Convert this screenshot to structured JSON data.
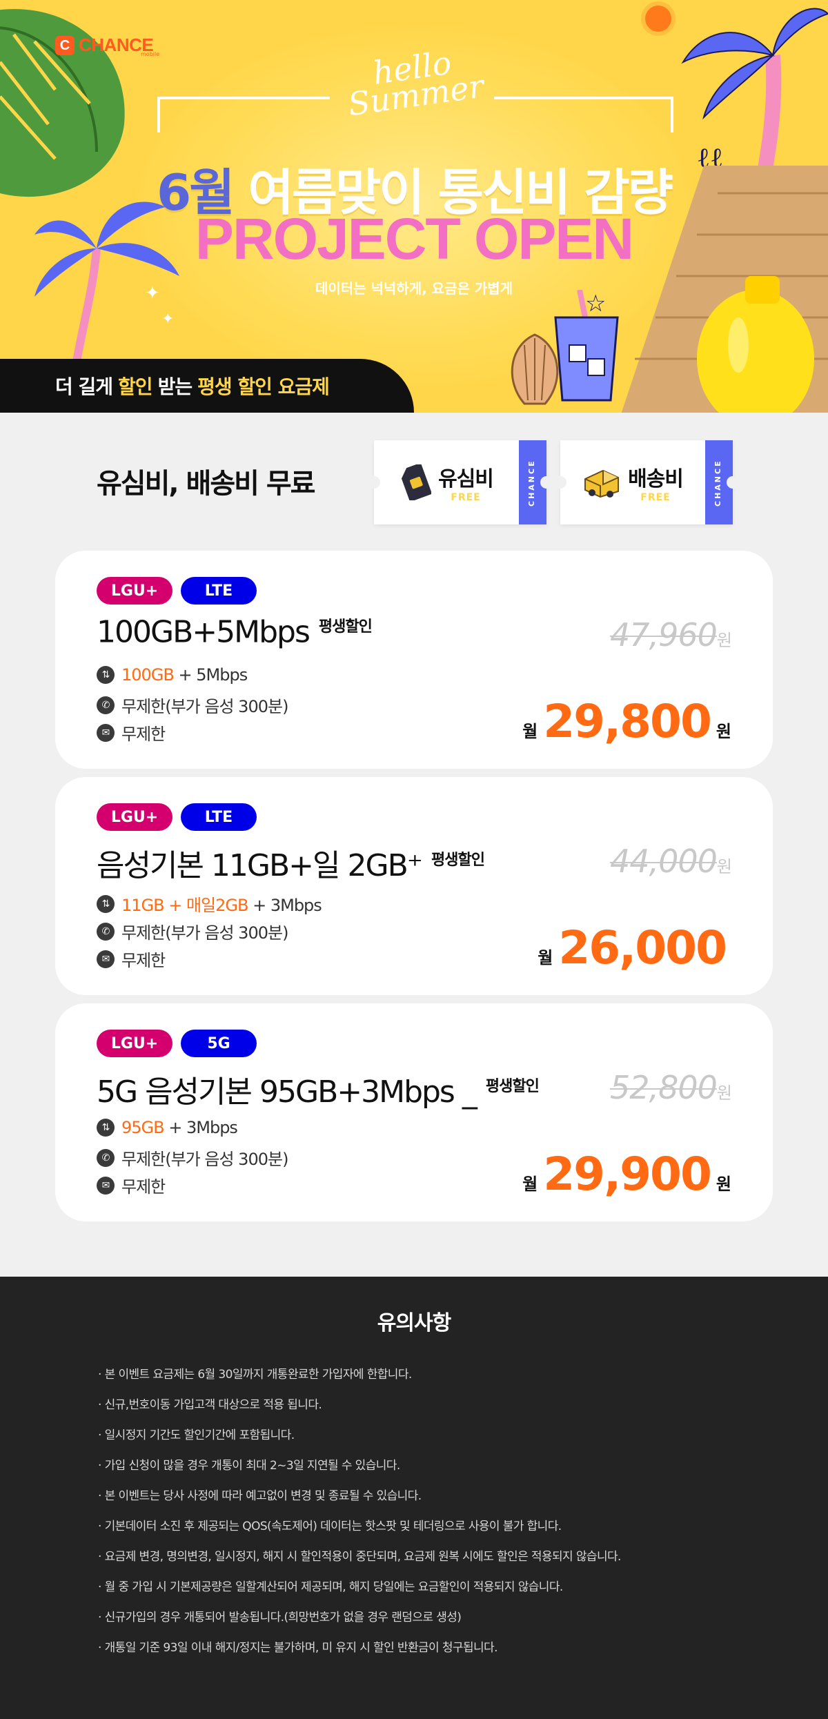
{
  "hero": {
    "brand": "CHANCE",
    "brand_sub": "mobile",
    "hello_line1": "hello",
    "hello_line2": "Summer",
    "headline_month": "6월",
    "headline_rest": " 여름맞이 통신비 감량",
    "project": "PROJECT OPEN",
    "subtitle": "데이터는 넉넉하게, 요금은 가볍게",
    "banner_pre": "더 길게",
    "banner_hl1": "할인",
    "banner_mid": "받는",
    "banner_hl2": "평생 할인 요금제",
    "colors": {
      "background": "#ffd64a",
      "accent_blue": "#5a67d8",
      "accent_pink": "#f26fc3"
    }
  },
  "free": {
    "title": "유심비, 배송비 무료",
    "tickets": [
      {
        "icon": "sim-card-icon",
        "name": "유심비",
        "free": "FREE",
        "stub": "CHANCE"
      },
      {
        "icon": "delivery-truck-icon",
        "name": "배송비",
        "free": "FREE",
        "stub": "CHANCE"
      }
    ]
  },
  "plans": [
    {
      "carrier": "LGU+",
      "network": "LTE",
      "name": "100GB+5Mbps",
      "tag": "평생할인",
      "data_hl": "100GB",
      "data_rest": " + 5Mbps",
      "voice": "무제한(부가 음성 300분)",
      "sms": "무제한",
      "orig_price": "47,960",
      "orig_unit": "원",
      "price_prefix": "월",
      "price": "29,800",
      "price_unit": "원"
    },
    {
      "carrier": "LGU+",
      "network": "LTE",
      "name": "음성기본 11GB+일 2GB⁺",
      "tag": "평생할인",
      "data_hl": "11GB + 매일2GB",
      "data_rest": " + 3Mbps",
      "voice": "무제한(부가 음성 300분)",
      "sms": "무제한",
      "orig_price": "44,000",
      "orig_unit": "원",
      "price_prefix": "월",
      "price": "26,000",
      "price_unit": ""
    },
    {
      "carrier": "LGU+",
      "network": "5G",
      "name": "5G 음성기본 95GB+3Mbps _",
      "tag": "평생할인",
      "data_hl": "95GB",
      "data_rest": " + 3Mbps",
      "voice": "무제한(부가 음성 300분)",
      "sms": "무제한",
      "orig_price": "52,800",
      "orig_unit": "원",
      "price_prefix": "월",
      "price": "29,900",
      "price_unit": "원"
    }
  ],
  "notice": {
    "title": "유의사항",
    "items": [
      "본 이벤트 요금제는 6월 30일까지 개통완료한 가입자에 한합니다.",
      "신규,번호이동 가입고객 대상으로 적용 됩니다.",
      "일시정지 기간도 할인기간에 포함됩니다.",
      "가입 신청이 많을 경우 개통이 최대 2~3일 지연될 수 있습니다.",
      "본 이벤트는 당사 사정에 따라 예고없이 변경 및 종료될 수 있습니다.",
      "기본데이터 소진 후 제공되는 QOS(속도제어) 데이터는 핫스팟 및 테더링으로 사용이 불가 합니다.",
      "요금제 변경, 명의변경, 일시정지, 해지 시 할인적용이 중단되며, 요금제 원복 시에도 할인은 적용되지 않습니다.",
      "월 중 가입 시 기본제공량은 일할계산되어 제공되며, 해지 당일에는 요금할인이 적용되지 않습니다.",
      "신규가입의 경우 개통되어 발송됩니다.(희망번호가 없을 경우 랜덤으로 생성)",
      "개통일 기준 93일 이내 해지/정지는 불가하며, 미 유지 시 할인 반환금이 청구됩니다."
    ]
  },
  "icons": {
    "data": "data-transfer-icon",
    "voice": "phone-icon",
    "sms": "chat-icon"
  }
}
